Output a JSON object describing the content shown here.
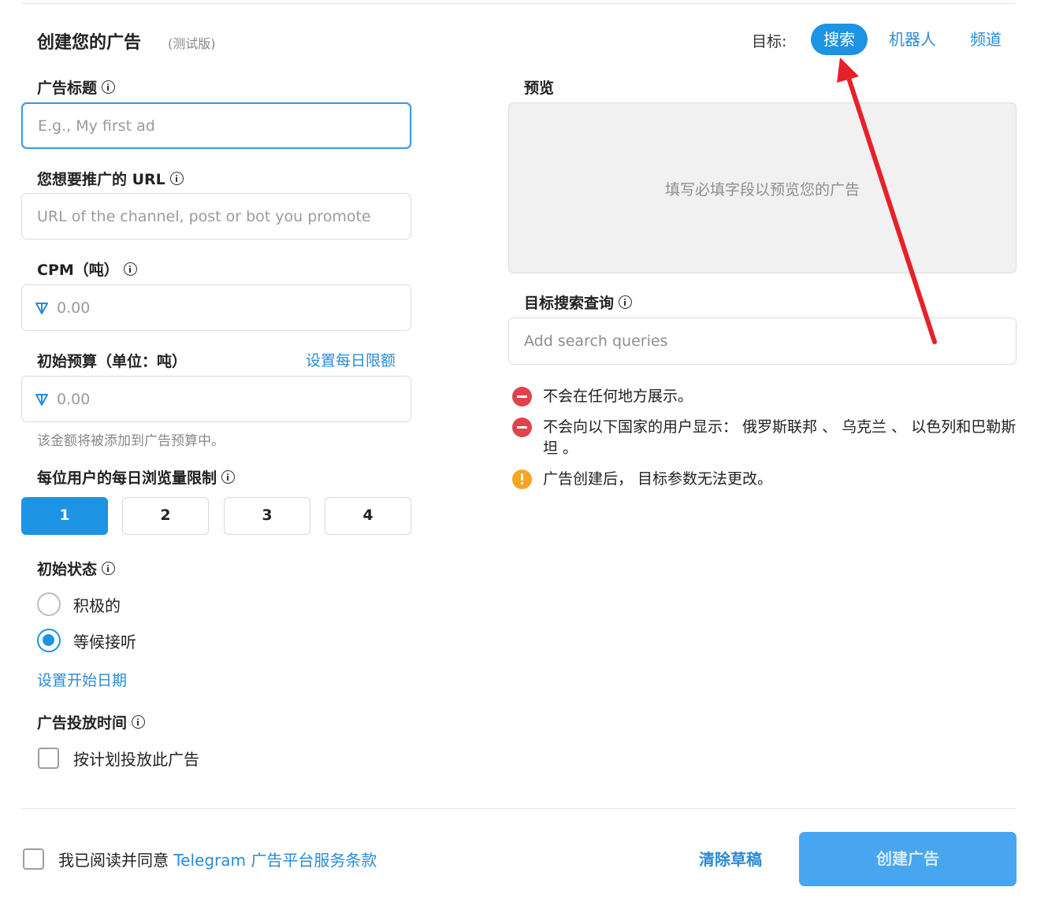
{
  "header": {
    "title": "创建您的广告",
    "beta": "(测试版)",
    "target_label": "目标:",
    "target_tabs": [
      {
        "label": "搜索",
        "active": true
      },
      {
        "label": "机器人",
        "active": false
      },
      {
        "label": "频道",
        "active": false
      }
    ]
  },
  "form": {
    "ad_title": {
      "label": "广告标题",
      "placeholder": "E.g., My first ad"
    },
    "url": {
      "label": "您想要推广的 URL",
      "placeholder": "URL of the channel, post or bot you promote"
    },
    "cpm": {
      "label": "CPM（吨）",
      "placeholder": "0.00"
    },
    "budget": {
      "label": "初始预算（单位：吨）",
      "daily_limit_link": "设置每日限额",
      "placeholder": "0.00",
      "hint": "该金额将被添加到广告预算中。"
    },
    "views_limit": {
      "label": "每位用户的每日浏览量限制",
      "options": [
        "1",
        "2",
        "3",
        "4"
      ],
      "selected": "1"
    },
    "initial_status": {
      "label": "初始状态",
      "options": [
        {
          "label": "积极的",
          "checked": false
        },
        {
          "label": "等候接听",
          "checked": true
        }
      ],
      "start_date_link": "设置开始日期"
    },
    "schedule": {
      "label": "广告投放时间",
      "checkbox_label": "按计划投放此广告"
    }
  },
  "preview": {
    "label": "预览",
    "empty_text": "填写必填字段以预览您的广告"
  },
  "search_queries": {
    "label": "目标搜索查询",
    "placeholder": "Add search queries"
  },
  "notes": [
    {
      "type": "error",
      "text": "不会在任何地方展示。"
    },
    {
      "type": "error",
      "text": "不会向以下国家的用户显示： 俄罗斯联邦 、 乌克兰 、 以色列和巴勒斯坦 。"
    },
    {
      "type": "warning",
      "text": "广告创建后， 目标参数无法更改。"
    }
  ],
  "footer": {
    "agree_prefix": "我已阅读并同意",
    "agree_link": "Telegram 广告平台服务条款",
    "clear_label": "清除草稿",
    "create_label": "创建广告"
  },
  "colors": {
    "accent": "#1c93e3",
    "link": "#2a8bd6",
    "error": "#e0434b",
    "warning": "#f5a623",
    "annotation_arrow": "#e8202a"
  }
}
